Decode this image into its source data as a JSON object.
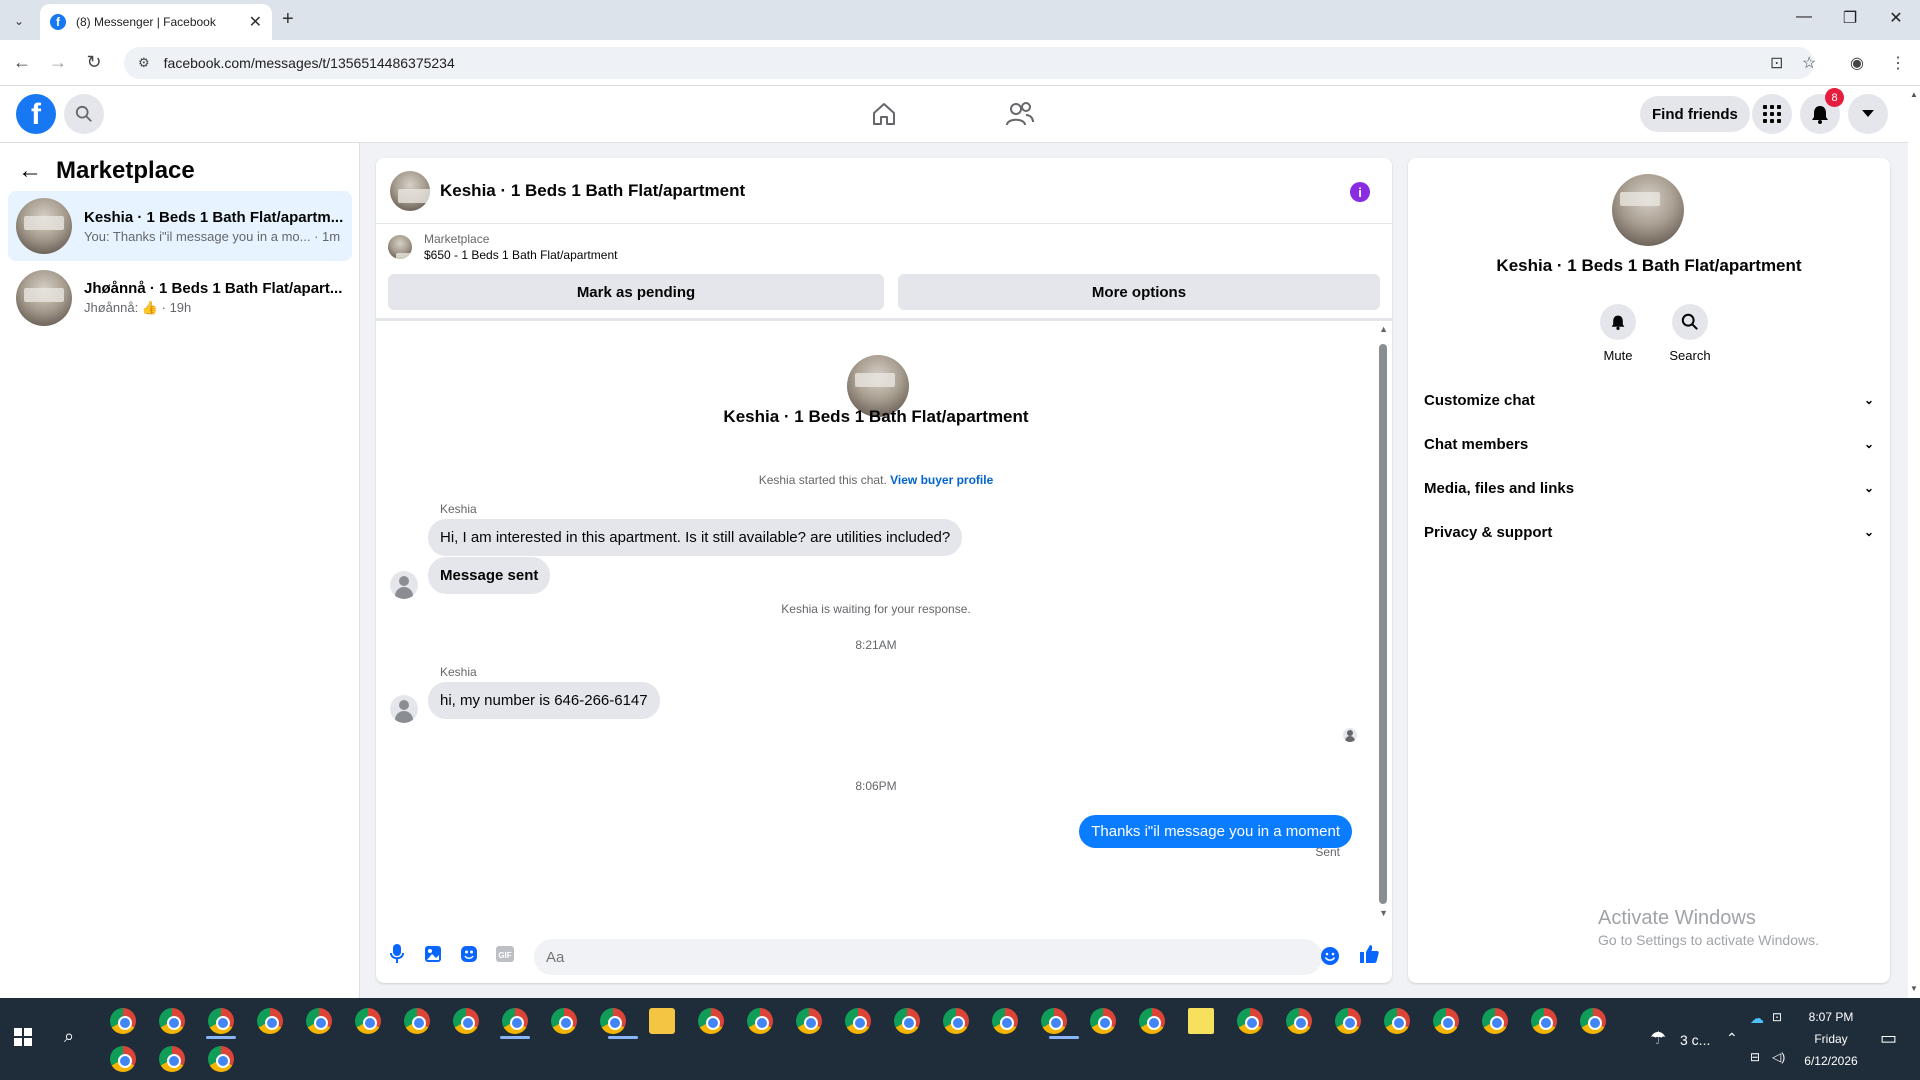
{
  "browser": {
    "tab_title": "(8) Messenger | Facebook",
    "url": "facebook.com/messages/t/1356514486375234"
  },
  "header": {
    "find_friends": "Find friends",
    "notification_count": "8"
  },
  "sidebar": {
    "title": "Marketplace",
    "conversations": [
      {
        "name": "Keshia · 1 Beds 1 Bath Flat/apartm...",
        "preview": "You: Thanks i\"il message you in a mo... · 1m"
      },
      {
        "name": "Jhøånnå · 1 Beds 1 Bath Flat/apart...",
        "preview_prefix": "Jhøånnå:",
        "preview_suffix": "· 19h"
      }
    ]
  },
  "chat": {
    "title": "Keshia · 1 Beds 1 Bath Flat/apartment",
    "listing_category": "Marketplace",
    "listing_desc": "$650 - 1 Beds 1 Bath Flat/apartment",
    "mark_pending": "Mark as pending",
    "more_options": "More options",
    "intro_name": "Keshia · 1 Beds 1 Bath Flat/apartment",
    "started_text": "Keshia started this chat.",
    "view_profile": "View buyer profile",
    "sender1": "Keshia",
    "msg1": "Hi, I am interested in this apartment. Is it still available? are utilities included?",
    "msg2": "Message sent",
    "waiting": "Keshia is waiting for your response.",
    "time1": "8:21AM",
    "sender2": "Keshia",
    "msg3": "hi, my number is 646-266-6147",
    "time2": "8:06PM",
    "out_msg": "Thanks i\"il message you in a moment",
    "sent": "Sent",
    "composer_placeholder": "Aa"
  },
  "right_panel": {
    "name": "Keshia · 1 Beds 1 Bath Flat/apartment",
    "mute": "Mute",
    "search": "Search",
    "sections": [
      "Customize chat",
      "Chat members",
      "Media, files and links",
      "Privacy & support"
    ]
  },
  "watermark": {
    "line1": "Activate Windows",
    "line2": "Go to Settings to activate Windows."
  },
  "taskbar": {
    "weather": "3 c...",
    "time": "8:07 PM",
    "day": "Friday",
    "date": "6/12/2026"
  },
  "colors": {
    "brand": "#1877f2",
    "outgoing_bubble": "#0a7cff",
    "badge": "#e41e3f",
    "info_icon": "#8a2be2"
  }
}
